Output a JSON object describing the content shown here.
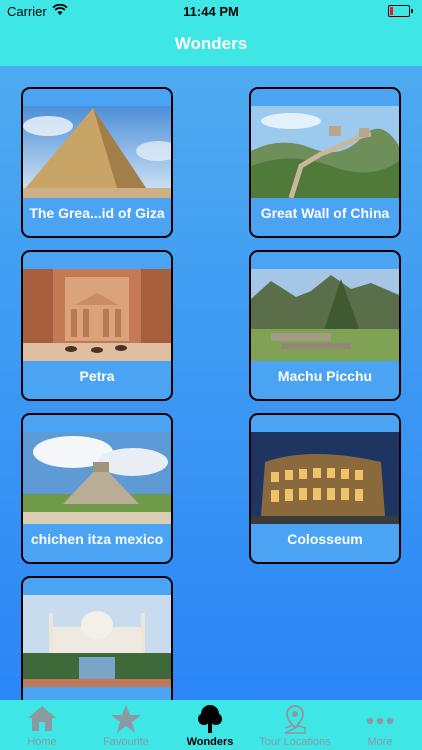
{
  "status_bar": {
    "carrier": "Carrier",
    "time": "11:44 PM"
  },
  "nav": {
    "title": "Wonders"
  },
  "wonders": [
    {
      "name": "The Grea...id of Giza"
    },
    {
      "name": "Great Wall of China"
    },
    {
      "name": "Petra"
    },
    {
      "name": "Machu Picchu"
    },
    {
      "name": "chichen itza mexico"
    },
    {
      "name": "Colosseum"
    },
    {
      "name": ""
    }
  ],
  "tabs": [
    {
      "label": "Home",
      "icon": "home-icon"
    },
    {
      "label": "Favourite",
      "icon": "star-icon"
    },
    {
      "label": "Wonders",
      "icon": "tree-icon"
    },
    {
      "label": "Tour Locations",
      "icon": "map-pin-icon"
    },
    {
      "label": "More",
      "icon": "more-icon"
    }
  ],
  "colors": {
    "bar": "#3ee6e6",
    "background": "#3aa0f2",
    "active_tab": "#000000",
    "inactive_tab": "#8a9aa0"
  }
}
